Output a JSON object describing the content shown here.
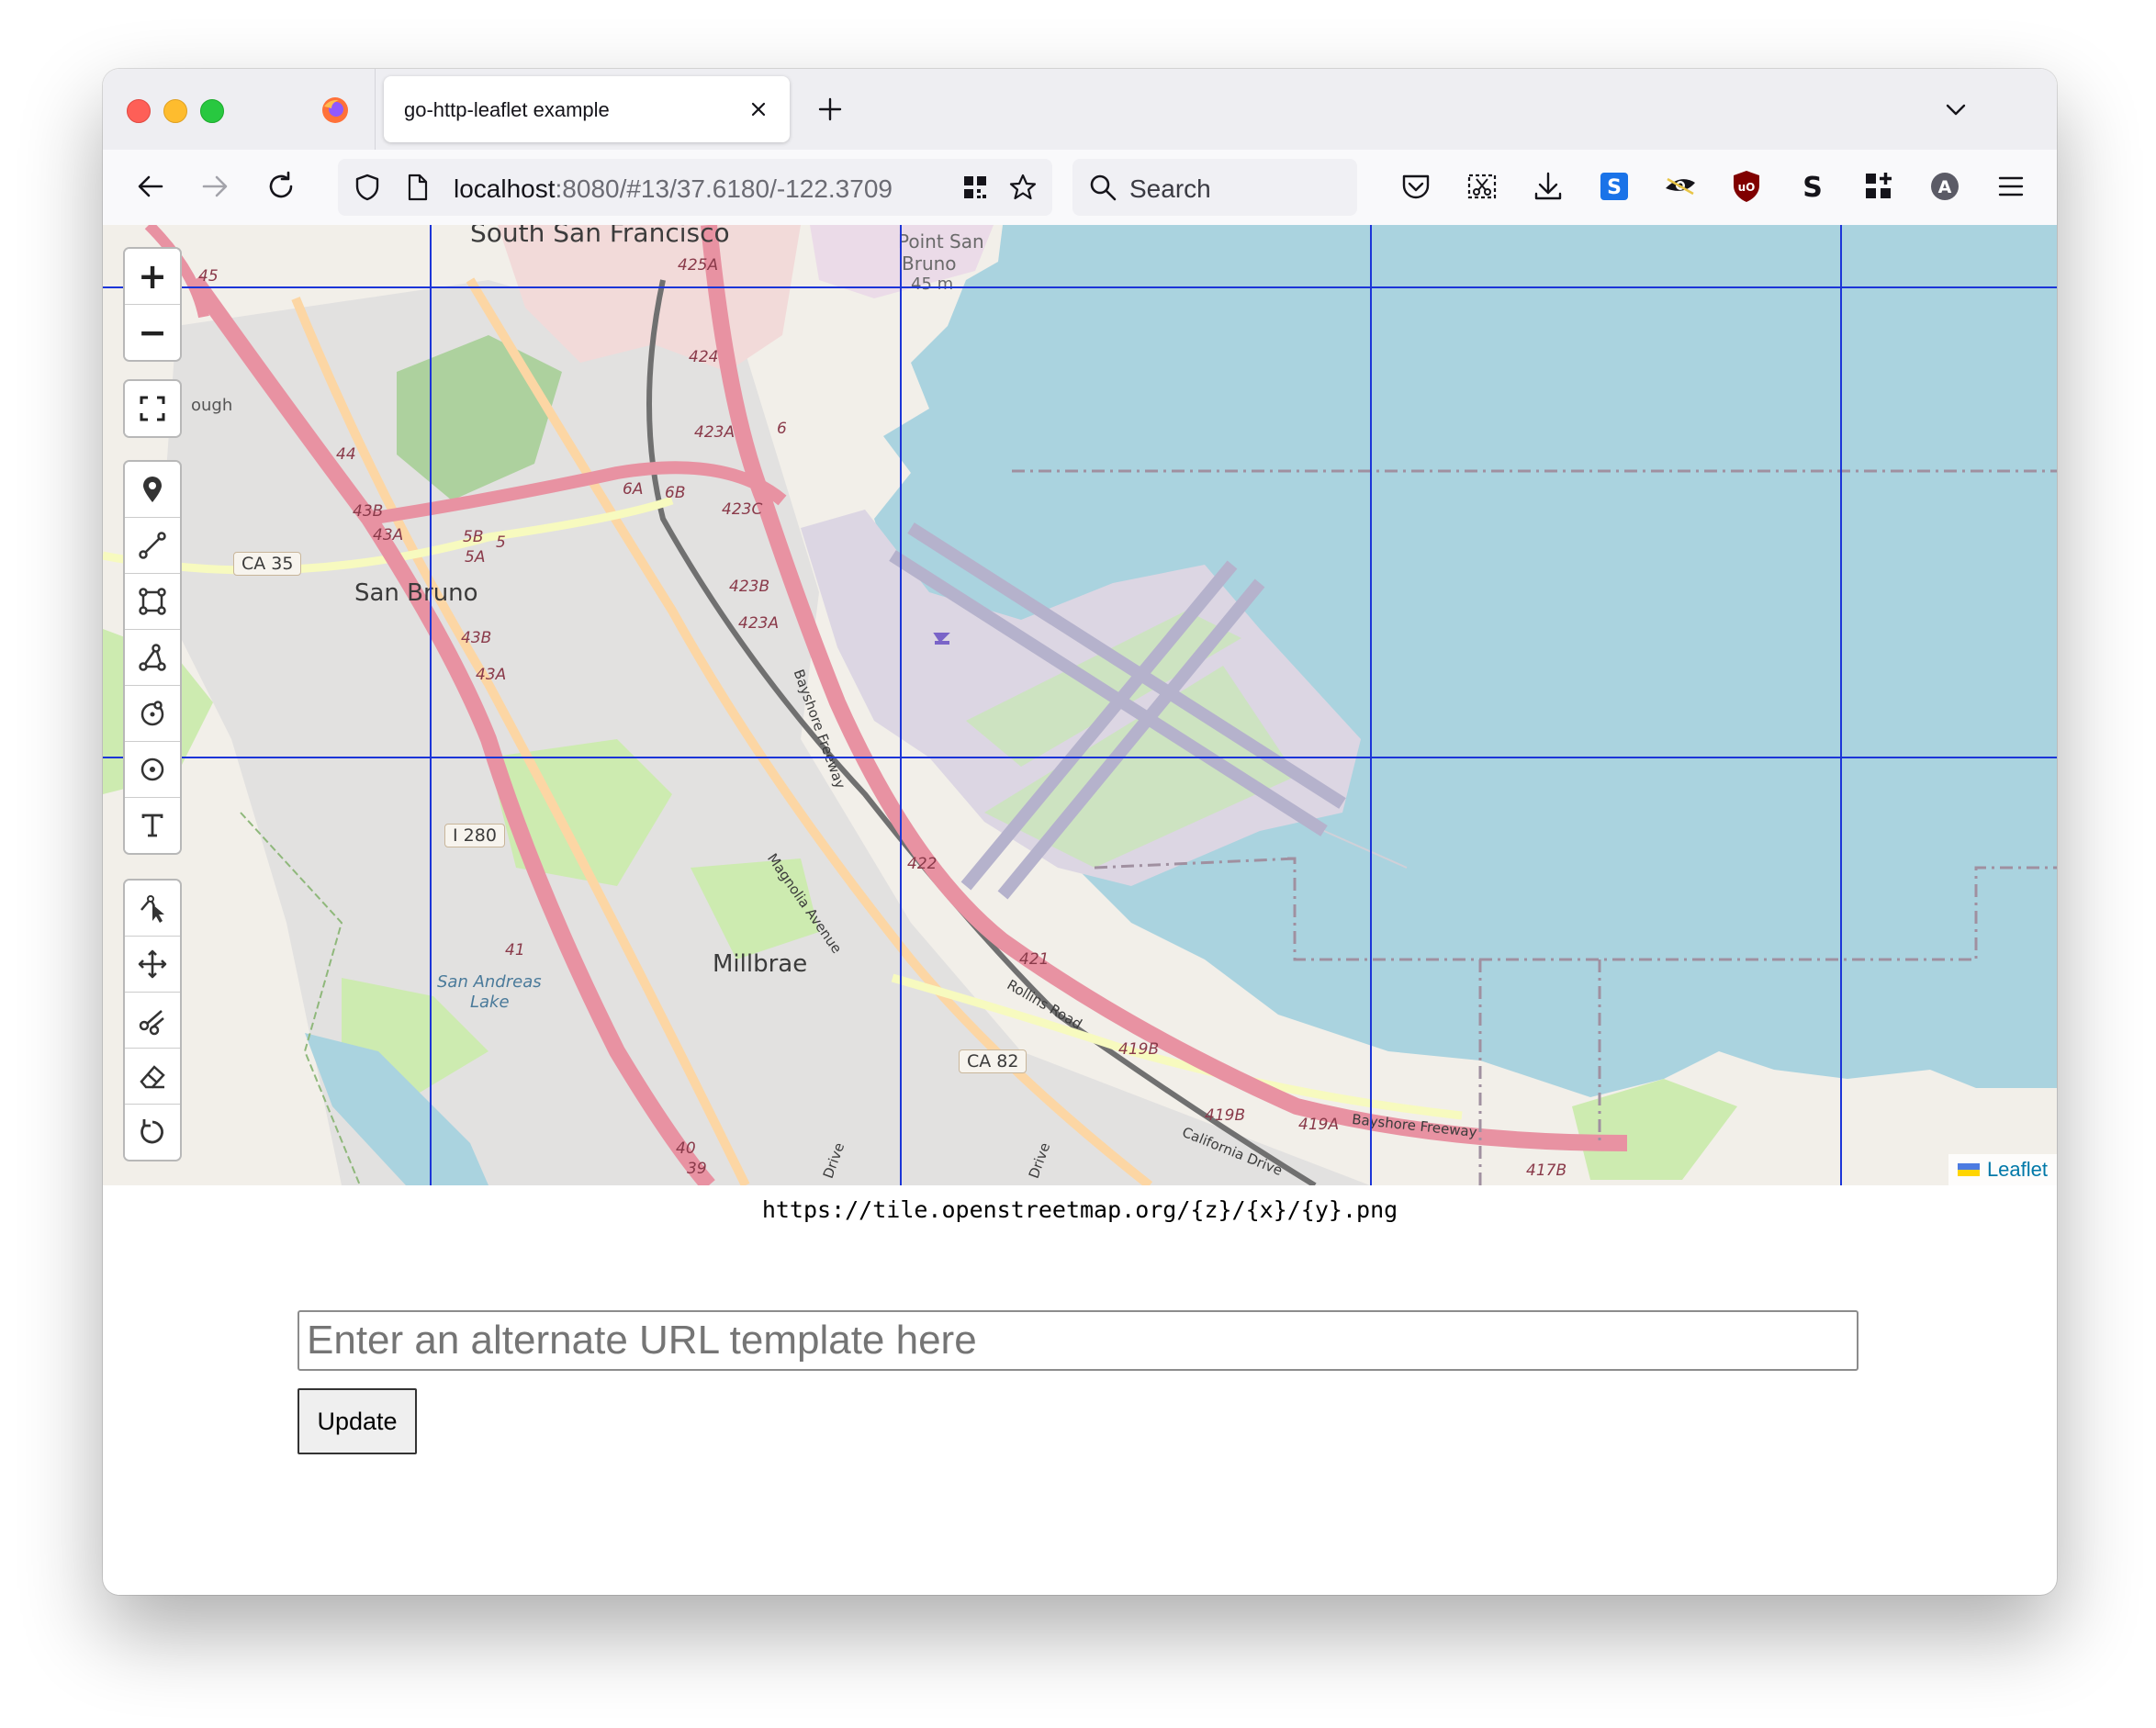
{
  "browser": {
    "tab_title": "go-http-leaflet example",
    "url_host": "localhost",
    "url_path": ":8080/#13/37.6180/-122.3709",
    "search_placeholder": "Search",
    "toolbar_icons": [
      "pocket-icon",
      "screenshot-icon",
      "download-icon",
      "extension-s-icon",
      "extension-eye-icon",
      "ublock-icon",
      "extension-s2-icon",
      "extensions-grid-icon",
      "account-icon",
      "menu-icon"
    ]
  },
  "map": {
    "labels": {
      "south_sf": "South San Francisco",
      "point_san_bruno": "Point San",
      "point_san_bruno2": "Bruno",
      "point_height": "45 m",
      "san_bruno": "San Bruno",
      "millbrae": "Millbrae",
      "san_andreas": "San Andreas",
      "lake": "Lake",
      "ca35": "CA 35",
      "i280": "I 280",
      "ca82": "CA 82",
      "bayshore": "Bayshore Freeway",
      "rollins": "Rollins Road",
      "magnolia": "Magnolia Avenue",
      "california": "California Drive",
      "bayshore2": "Bayshore Freeway",
      "exit_425a": "425A",
      "exit_424": "424",
      "exit_423a": "423A",
      "exit_423c": "423C",
      "exit_423b": "423B",
      "exit_423a2": "423A",
      "exit_422": "422",
      "exit_421": "421",
      "exit_419b": "419B",
      "exit_419b2": "419B",
      "exit_419a": "419A",
      "exit_417b": "417B",
      "exit_6a": "6A",
      "exit_6b": "6B",
      "exit_6": "6",
      "exit_5b": "5B",
      "exit_5a": "5A",
      "exit_5": "5",
      "exit_44": "44",
      "exit_43b": "43B",
      "exit_43a": "43A",
      "exit_43b2": "43B",
      "exit_43a2": "43A",
      "exit_41": "41",
      "exit_40": "40",
      "exit_39": "39",
      "exit_45": "45",
      "ough": "ough",
      "drive1": "Drive",
      "drive2": "Drive"
    },
    "controls": {
      "zoom_in": "+",
      "zoom_out": "−",
      "draw_tools": [
        "marker-icon",
        "polyline-icon",
        "rectangle-icon",
        "polygon-icon",
        "circle-marker-icon",
        "circle-icon",
        "text-icon"
      ],
      "edit_tools": [
        "edit-vertex-icon",
        "move-icon",
        "cut-icon",
        "eraser-icon",
        "rotate-icon"
      ]
    },
    "attribution": "Leaflet"
  },
  "page": {
    "tile_template": "https://tile.openstreetmap.org/{z}/{x}/{y}.png",
    "input_placeholder": "Enter an alternate URL template here",
    "update_label": "Update"
  },
  "colors": {
    "water": "#aad3df",
    "land": "#f2efe9",
    "grid": "#1c35d8",
    "motorway": "#e892a2",
    "primary_road": "#fcd6a4",
    "airport": "#d9d0c9"
  }
}
